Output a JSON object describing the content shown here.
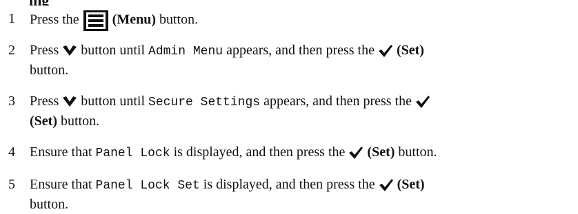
{
  "heading_fragment": "ing",
  "steps": [
    {
      "number": "1",
      "press": "Press the ",
      "menu_label": "(Menu)",
      "after": " button."
    },
    {
      "number": "2",
      "press": "Press ",
      "mid": " button until ",
      "code": "Admin Menu",
      "appears": " appears, and then press the ",
      "set_label": "(Set)",
      "end": "button."
    },
    {
      "number": "3",
      "press": "Press ",
      "mid": " button until ",
      "code": "Secure Settings",
      "appears": " appears, and then press the ",
      "set_label": "(Set)",
      "end": " button."
    },
    {
      "number": "4",
      "ensure": "Ensure that ",
      "code": "Panel Lock",
      "displayed": " is displayed, and then press the ",
      "set_label": "(Set)",
      "end": " button."
    },
    {
      "number": "5",
      "ensure": "Ensure that ",
      "code": "Panel Lock Set",
      "displayed": " is displayed, and then press the ",
      "set_label": "(Set)",
      "end": "button."
    }
  ],
  "icons": {
    "menu": "menu-icon",
    "down": "chevron-down-icon",
    "check": "checkmark-icon"
  }
}
